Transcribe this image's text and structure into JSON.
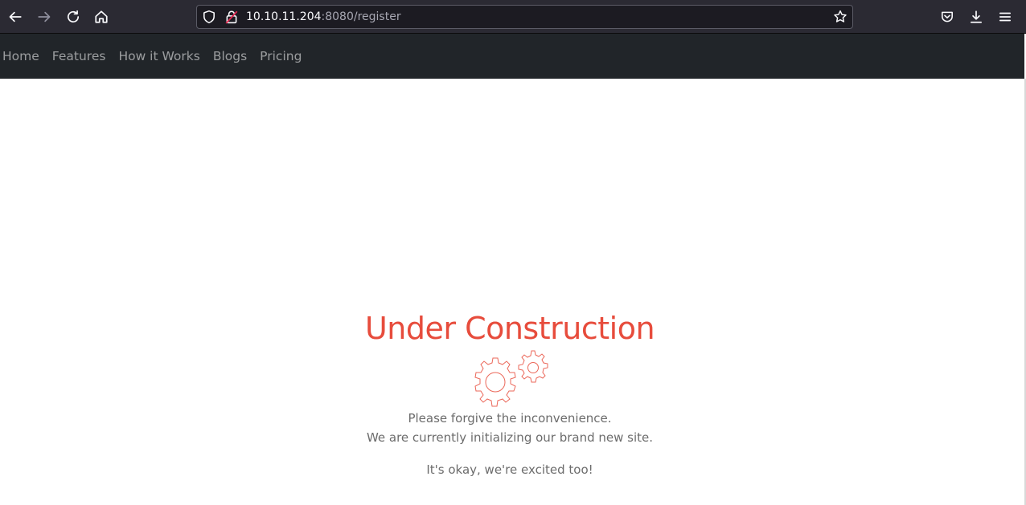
{
  "browser": {
    "url_host": "10.10.11.204",
    "url_rest": ":8080/register",
    "icons": [
      "back-arrow-icon",
      "forward-arrow-icon",
      "reload-icon",
      "home-icon",
      "shield-icon",
      "lock-warning-icon",
      "bookmark-star-icon",
      "pocket-icon",
      "download-icon",
      "menu-icon"
    ]
  },
  "navbar": {
    "links": [
      "Home",
      "Features",
      "How it Works",
      "Blogs",
      "Pricing"
    ]
  },
  "page": {
    "title": "Under Construction",
    "line1": "Please forgive the inconvenience.",
    "line2": "We are currently initializing our brand new site.",
    "line3": "It's okay, we're excited too!",
    "accent_color": "#e74c3c",
    "gear_icon": "gears-icon"
  }
}
